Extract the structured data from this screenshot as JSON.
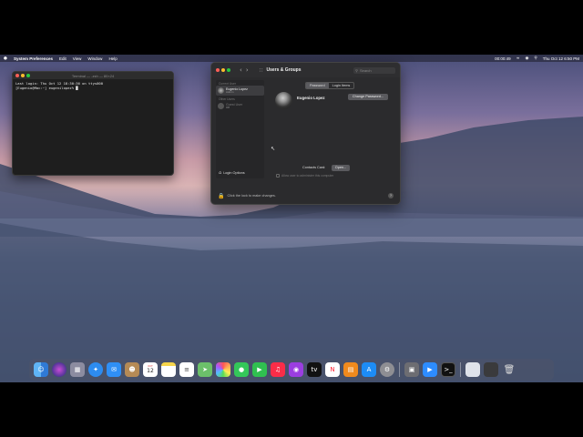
{
  "menubar": {
    "apple": "",
    "items": [
      "System Preferences",
      "Edit",
      "View",
      "Window",
      "Help"
    ],
    "status_time": "00:00:49",
    "date_time": "Thu Oct 12  6:50 PM"
  },
  "terminal": {
    "title": "Terminal — -zsh — 80×24",
    "lines": [
      "Last login: Thu Oct 12 18:30:36 on ttys000",
      "[Eugenio@Mac:~] eugenilopez% █"
    ]
  },
  "prefs": {
    "title": "Users & Groups",
    "search_placeholder": "Search",
    "sidebar": {
      "current_user_header": "Current User",
      "current_user": {
        "name": "Eugenio Lopez",
        "role": "Admin"
      },
      "other_users_header": "Other Users",
      "other_user": {
        "name": "Guest User",
        "role": "Off"
      },
      "login_options": "Login Options"
    },
    "tabs": [
      "Password",
      "Login Items"
    ],
    "full_name": "Eugenio Lopez",
    "change_password": "Change Password...",
    "contacts_card_label": "Contacts Card:",
    "open_button": "Open...",
    "allow_admin": "Allow user to administer this computer",
    "lock_text": "Click the lock to make changes.",
    "help": "?"
  },
  "dock": {
    "calendar_month": "OCT",
    "calendar_day": "12",
    "apps": [
      "finder",
      "siri",
      "launchpad",
      "safari",
      "mail",
      "contacts",
      "calendar",
      "notes",
      "reminders",
      "maps",
      "photos",
      "messages",
      "facetime",
      "music",
      "podcasts",
      "tv",
      "news",
      "books",
      "app-store",
      "system-preferences",
      "screenshot",
      "zoom",
      "terminal",
      "downloads",
      "trash"
    ]
  },
  "colors": {
    "accent": "#0a84ff",
    "lock": "#e8b95b",
    "close": "#ff5f57",
    "minimize": "#febc2e",
    "zoom": "#28c840"
  }
}
